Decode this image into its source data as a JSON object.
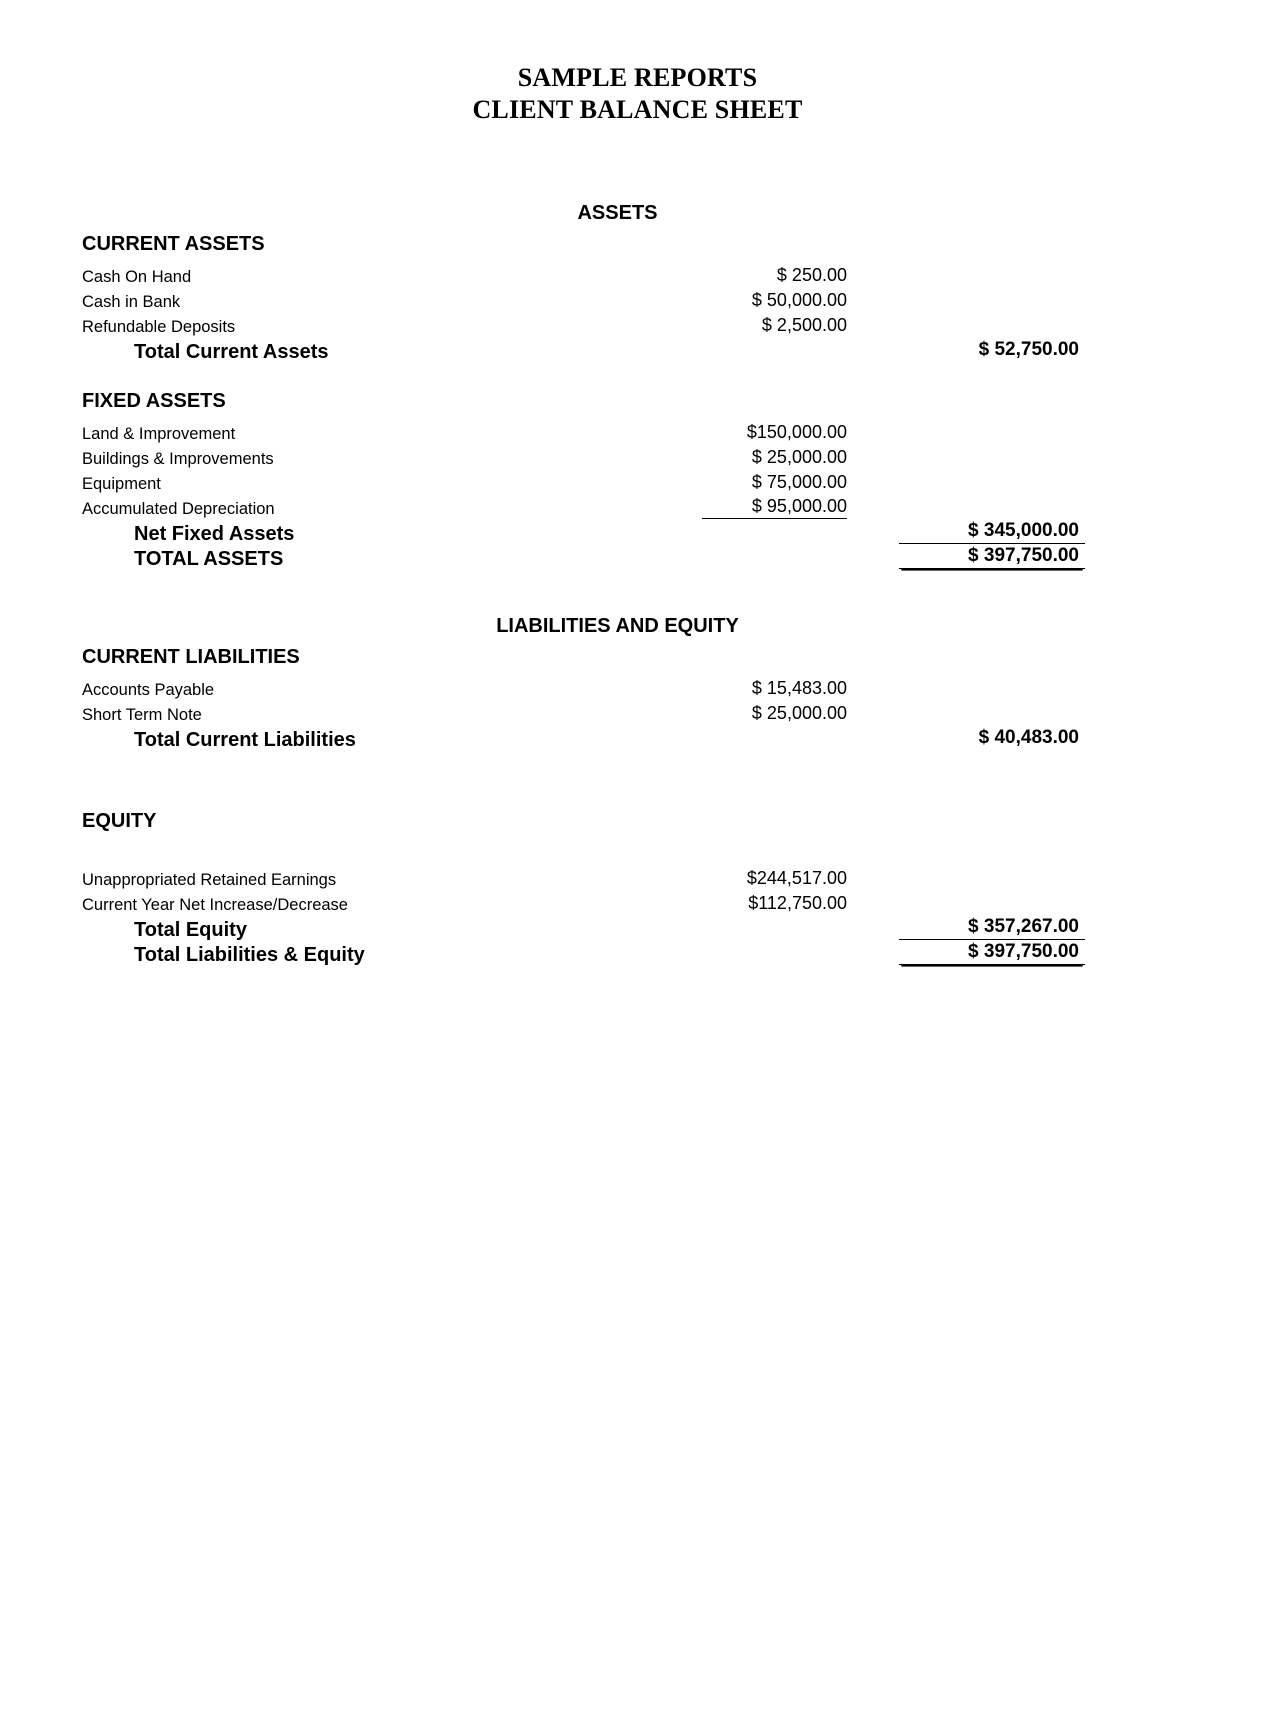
{
  "document": {
    "title_line_1": "SAMPLE REPORTS",
    "title_line_2": "CLIENT BALANCE SHEET"
  },
  "assets": {
    "banner": "ASSETS",
    "current_assets": {
      "heading": "CURRENT ASSETS",
      "rows": [
        {
          "label": "Cash On Hand",
          "amount": "$     250.00"
        },
        {
          "label": "Cash in Bank",
          "amount": "$ 50,000.00"
        },
        {
          "label": "Refundable Deposits",
          "amount": "$  2,500.00"
        }
      ],
      "total_label": "Total Current Assets",
      "total_amount": "$  52,750.00"
    },
    "fixed_assets": {
      "heading": "FIXED ASSETS",
      "rows": [
        {
          "label": "Land & Improvement",
          "amount": "$150,000.00"
        },
        {
          "label": "Buildings & Improvements",
          "amount": "$ 25,000.00"
        },
        {
          "label": "Equipment",
          "amount": "$ 75,000.00"
        },
        {
          "label": "Accumulated Depreciation",
          "amount": "$ 95,000.00"
        }
      ],
      "net_label": "Net Fixed Assets",
      "net_amount": "$ 345,000.00"
    },
    "total_assets_label": "TOTAL ASSETS",
    "total_assets_amount": "$ 397,750.00"
  },
  "liabilities_equity": {
    "banner": "LIABILITIES AND EQUITY",
    "current_liabilities": {
      "heading": "CURRENT LIABILITIES",
      "rows": [
        {
          "label": "Accounts Payable",
          "amount": "$ 15,483.00"
        },
        {
          "label": "Short Term Note",
          "amount": "$ 25,000.00"
        }
      ],
      "total_label": "Total Current Liabilities",
      "total_amount": "$   40,483.00"
    },
    "equity": {
      "heading": "EQUITY",
      "rows": [
        {
          "label": "Unappropriated Retained Earnings",
          "amount": "$244,517.00"
        },
        {
          "label": "Current Year Net Increase/Decrease",
          "amount": "$112,750.00"
        }
      ],
      "total_label": "Total Equity",
      "total_amount": "$ 357,267.00"
    },
    "total_label": "Total Liabilities & Equity",
    "total_amount": "$ 397,750.00"
  }
}
